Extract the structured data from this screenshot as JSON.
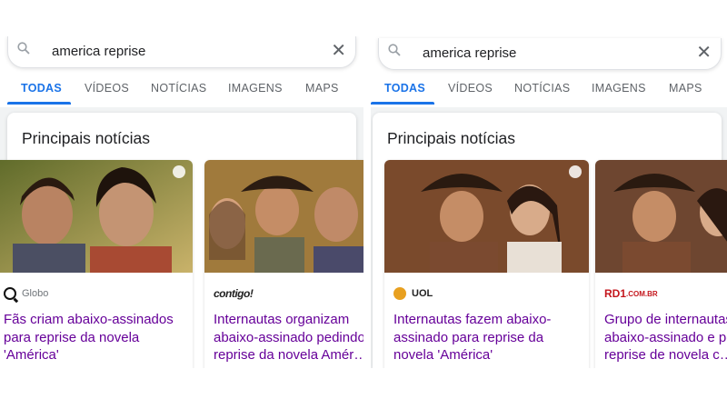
{
  "left_screen": {
    "search": {
      "query": "america reprise"
    },
    "tabs": [
      "TODAS",
      "VÍDEOS",
      "NOTÍCIAS",
      "IMAGENS",
      "MAPS"
    ],
    "section_title": "Principais notícias",
    "articles": [
      {
        "source": "Globo",
        "headline": "Fãs criam abaixo-assinados para reprise da novela 'América'"
      },
      {
        "source_logo": "contigo!",
        "headline": "Internautas organizam abaixo-assinado pedindo reprise da novela Amér…"
      }
    ]
  },
  "right_screen": {
    "search": {
      "query": "america reprise"
    },
    "tabs": [
      "TODAS",
      "VÍDEOS",
      "NOTÍCIAS",
      "IMAGENS",
      "MAPS"
    ],
    "section_title": "Principais notícias",
    "articles": [
      {
        "source_logo": "UOL",
        "headline": "Internautas fazem abaixo-assinado para reprise da novela 'América'"
      },
      {
        "source_logo_main": "RD1",
        "source_logo_suffix": ".COM.BR",
        "headline": "Grupo de internautas faz abaixo-assinado e pede reprise de novela c…"
      }
    ]
  },
  "colors": {
    "accent": "#1a73e8",
    "visited_link": "#660099",
    "background": "#f1f3f4"
  }
}
